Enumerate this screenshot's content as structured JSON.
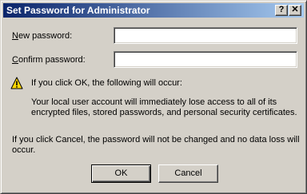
{
  "window": {
    "title": "Set Password for Administrator",
    "help_glyph": "?",
    "close_glyph": "✕"
  },
  "form": {
    "new_password_prefix": "N",
    "new_password_rest": "ew password:",
    "new_password_value": "",
    "confirm_password_prefix": "C",
    "confirm_password_rest": "onfirm password:",
    "confirm_password_value": ""
  },
  "warning": {
    "icon": "warning-icon",
    "heading": "If you click OK, the following will occur:",
    "detail": "Your local user account will immediately lose access to all of its encrypted files, stored passwords, and personal security certificates."
  },
  "cancel_note": "If you click Cancel, the password will not be changed and no data loss will occur.",
  "buttons": {
    "ok": "OK",
    "cancel": "Cancel"
  }
}
